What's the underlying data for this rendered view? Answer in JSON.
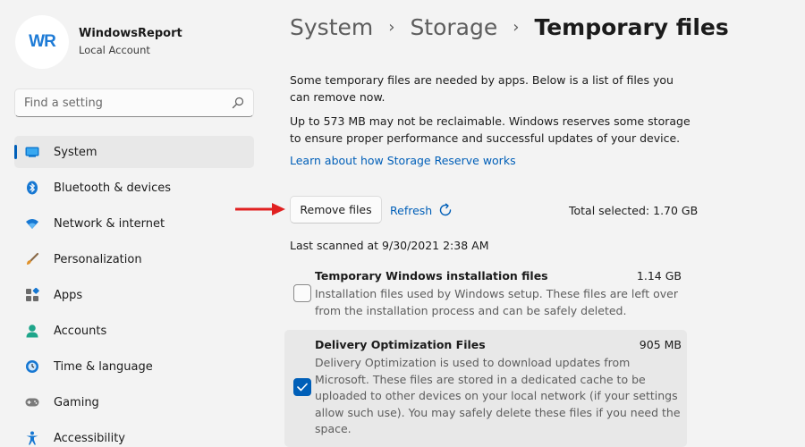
{
  "account": {
    "avatar_text": "WR",
    "name": "WindowsReport",
    "type": "Local Account"
  },
  "search": {
    "placeholder": "Find a setting",
    "icon": "search-icon"
  },
  "nav": {
    "items": [
      {
        "label": "System",
        "icon": "system-icon",
        "selected": true
      },
      {
        "label": "Bluetooth & devices",
        "icon": "bluetooth-icon"
      },
      {
        "label": "Network & internet",
        "icon": "wifi-icon"
      },
      {
        "label": "Personalization",
        "icon": "brush-icon"
      },
      {
        "label": "Apps",
        "icon": "apps-icon"
      },
      {
        "label": "Accounts",
        "icon": "person-icon"
      },
      {
        "label": "Time & language",
        "icon": "clock-globe-icon"
      },
      {
        "label": "Gaming",
        "icon": "gamepad-icon"
      },
      {
        "label": "Accessibility",
        "icon": "accessibility-icon"
      }
    ]
  },
  "breadcrumb": {
    "items": [
      "System",
      "Storage"
    ],
    "current": "Temporary files",
    "separator": "›"
  },
  "main": {
    "intro": "Some temporary files are needed by apps. Below is a list of files you can remove now.",
    "reserve_note": "Up to 573 MB may not be reclaimable. Windows reserves some storage to ensure proper performance and successful updates of your device.",
    "learn_link": "Learn about how Storage Reserve works",
    "remove_button": "Remove files",
    "refresh_label": "Refresh",
    "total_selected": "Total selected: 1.70 GB",
    "last_scanned": "Last scanned at 9/30/2021 2:38 AM"
  },
  "files": [
    {
      "title": "Temporary Windows installation files",
      "size": "1.14 GB",
      "description": "Installation files used by Windows setup.  These files are left over from the installation process and can be safely deleted.",
      "checked": false
    },
    {
      "title": "Delivery Optimization Files",
      "size": "905 MB",
      "description": "Delivery Optimization is used to download updates from Microsoft. These files are stored in a dedicated cache to be uploaded to other devices on your local network (if your settings allow such use). You may safely delete these files if you need the space.",
      "checked": true
    }
  ],
  "colors": {
    "accent": "#005fb8",
    "annotation_arrow": "#e02020",
    "background": "#f3f3f3"
  }
}
